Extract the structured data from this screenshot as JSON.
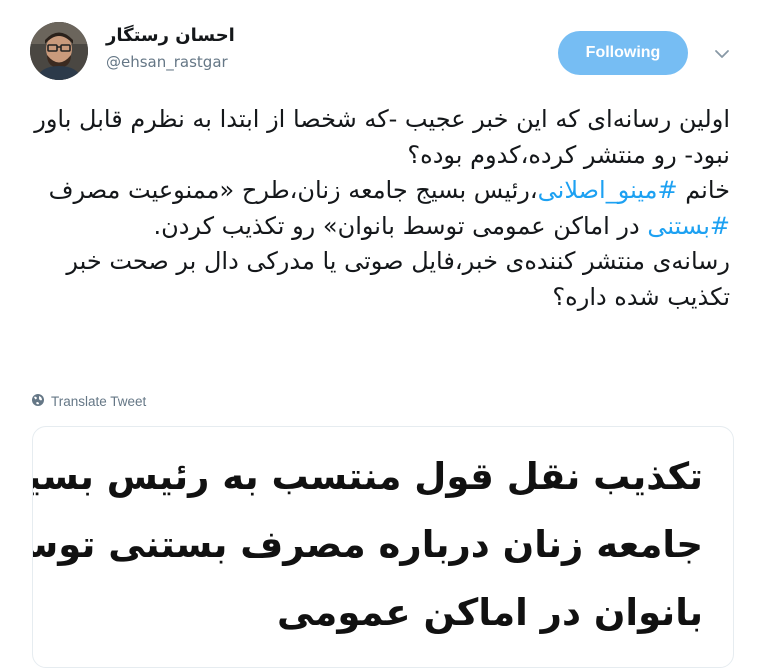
{
  "author": {
    "display_name": "احسان رستگار",
    "handle": "@ehsan_rastgar"
  },
  "follow_button": {
    "label": "Following"
  },
  "tweet": {
    "p1": "اولین رسانه‌ای که این خبر عجیب -که شخصا از ابتدا به نظرم قابل باور نبود- رو منتشر کرده،کدوم بوده؟",
    "p2_prefix": "خانم ",
    "hashtag1": "#مینو_اصلانی",
    "p2_mid": "،رئیس بسیج جامعه زنان،طرح «ممنوعیت مصرف ",
    "hashtag2": "#بستنی",
    "p2_suffix": " در اماکن عمومی توسط بانوان» رو تکذیب کردن.",
    "p3": "رسانه‌ی منتشر کننده‌ی خبر،فایل صوتی یا مدرکی دال بر صحت خبر تکذیب شده داره؟"
  },
  "translate": {
    "label": "Translate Tweet",
    "icon": "globe-icon"
  },
  "media": {
    "headline_lines": [
      "تکذیب نقل قول منتسب به رئیس بسیج",
      "جامعه زنان درباره مصرف بستنی توسط",
      "بانوان در اماکن عمومی"
    ]
  },
  "colors": {
    "link": "#1da1f2",
    "follow_button_bg": "#76bdf3",
    "muted": "#657786"
  }
}
